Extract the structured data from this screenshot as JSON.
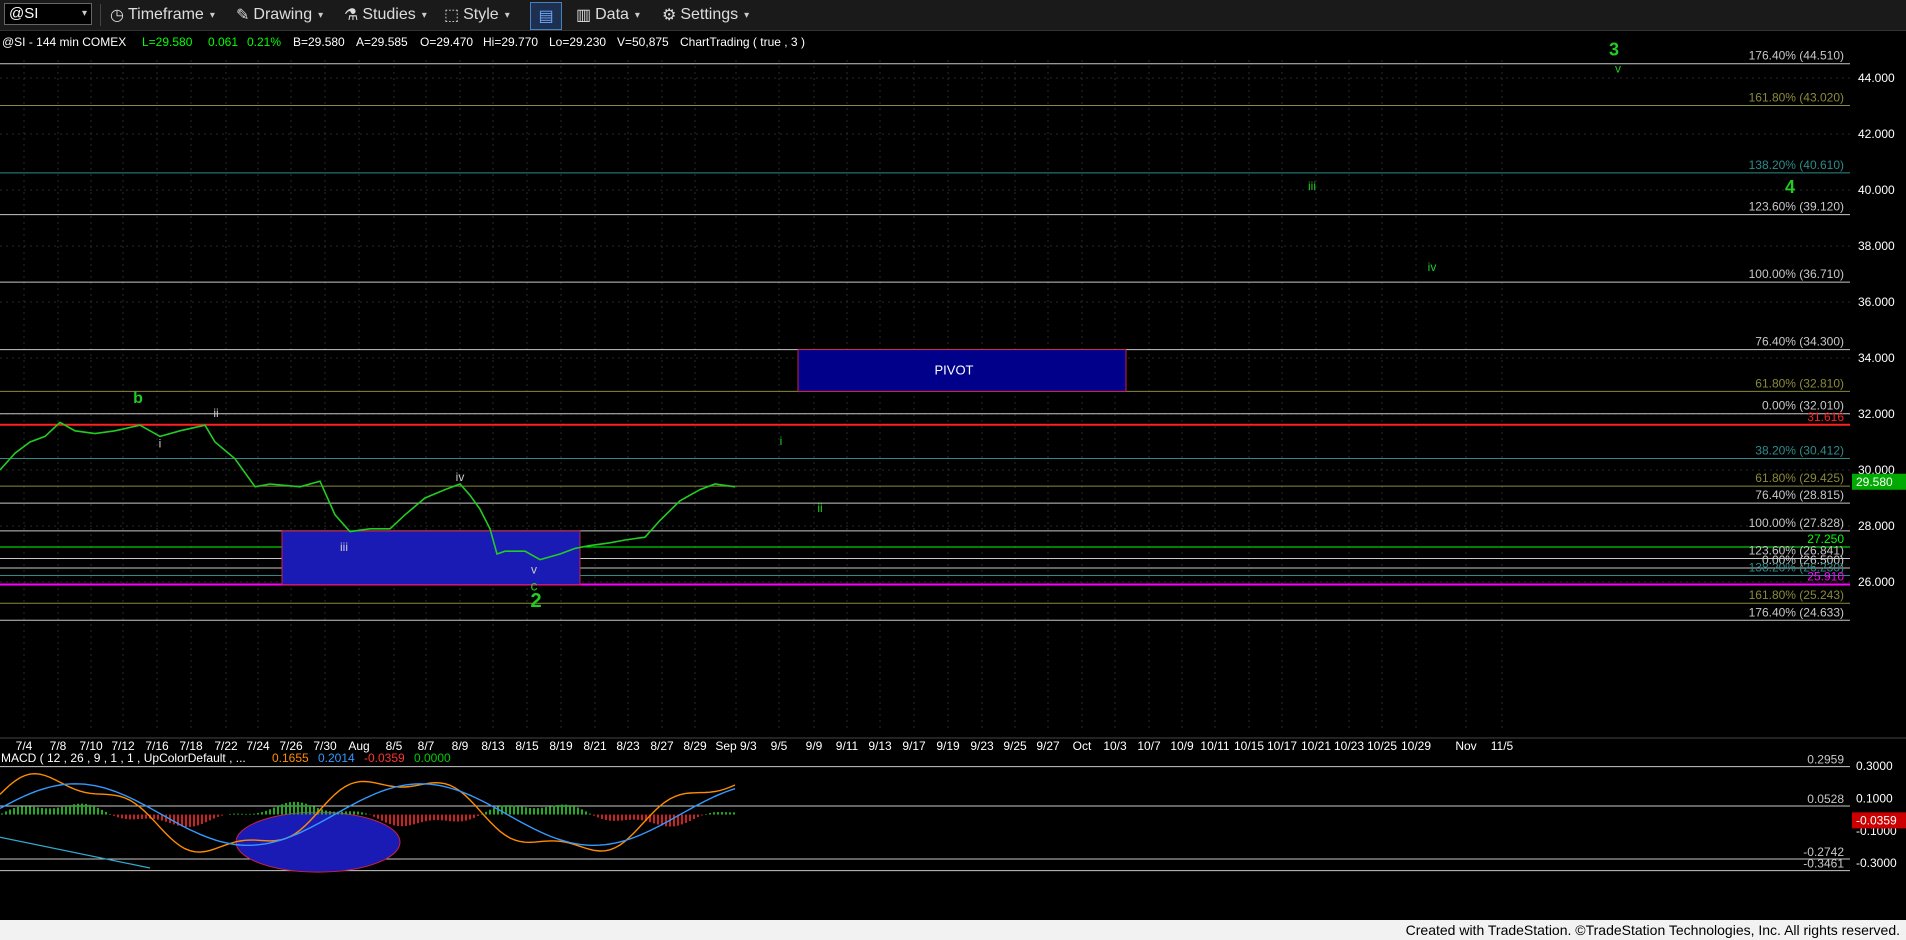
{
  "toolbar": {
    "symbol": "@SI",
    "timeframe": "Timeframe",
    "drawing": "Drawing",
    "studies": "Studies",
    "style": "Style",
    "data": "Data",
    "settings": "Settings"
  },
  "header": {
    "symbol_line": "@SI - 144 min  COMEX",
    "last": "L=29.580",
    "change": "0.061",
    "change_pct": "0.21%",
    "bid": "B=29.580",
    "ask": "A=29.585",
    "open": "O=29.470",
    "high": "Hi=29.770",
    "low": "Lo=29.230",
    "volume": "V=50,875",
    "study": "ChartTrading ( true , 3 )"
  },
  "price_axis": {
    "ticks": [
      "44.000",
      "42.000",
      "40.000",
      "38.000",
      "36.000",
      "34.000",
      "32.000",
      "30.000",
      "28.000",
      "26.000"
    ],
    "last_price": "29.580"
  },
  "fib_lines": [
    {
      "label": "176.40% (44.510)",
      "price": 44.51,
      "color": "#c8c8c8"
    },
    {
      "label": "161.80% (43.020)",
      "price": 43.02,
      "color": "#8a8a3a"
    },
    {
      "label": "138.20% (40.610)",
      "price": 40.61,
      "color": "#2e8b8b"
    },
    {
      "label": "123.60% (39.120)",
      "price": 39.12,
      "color": "#c8c8c8"
    },
    {
      "label": "100.00% (36.710)",
      "price": 36.71,
      "color": "#c8c8c8"
    },
    {
      "label": "76.40% (34.300)",
      "price": 34.3,
      "color": "#c8c8c8"
    },
    {
      "label": "61.80% (32.810)",
      "price": 32.81,
      "color": "#8a8a3a"
    },
    {
      "label": "0.00% (32.010)",
      "price": 32.01,
      "color": "#c8c8c8"
    },
    {
      "label": "31.616",
      "price": 31.616,
      "color": "#ff2020"
    },
    {
      "label": "38.20% (30.412)",
      "price": 30.412,
      "color": "#2e8b8b"
    },
    {
      "label": "61.80% (29.425)",
      "price": 29.425,
      "color": "#8a8a3a"
    },
    {
      "label": "76.40% (28.815)",
      "price": 28.815,
      "color": "#c8c8c8"
    },
    {
      "label": "100.00% (27.828)",
      "price": 27.828,
      "color": "#c8c8c8"
    },
    {
      "label": "27.250",
      "price": 27.25,
      "color": "#00ff00"
    },
    {
      "label": "123.60% (26.841)",
      "price": 26.841,
      "color": "#c8c8c8"
    },
    {
      "label": "0.00% (26.500)",
      "price": 26.5,
      "color": "#c8c8c8"
    },
    {
      "label": "138.20% (26.230)",
      "price": 26.23,
      "color": "#2e8b8b"
    },
    {
      "label": "25.910",
      "price": 25.91,
      "color": "#ff00ff"
    },
    {
      "label": "161.80% (25.243)",
      "price": 25.243,
      "color": "#8a8a3a"
    },
    {
      "label": "176.40% (24.633)",
      "price": 24.633,
      "color": "#c8c8c8"
    }
  ],
  "pivot": {
    "label": "PIVOT",
    "top": 34.3,
    "bottom": 32.81
  },
  "wave_labels": [
    {
      "text": "3",
      "price": 44.8,
      "col": "x3",
      "size": 18,
      "color": "#22cc22"
    },
    {
      "text": "v",
      "price": 44.2,
      "col": "xv3",
      "size": 12,
      "color": "#22cc22"
    },
    {
      "text": "iii",
      "price": 40.0,
      "col": "xiii",
      "size": 12,
      "color": "#22cc22"
    },
    {
      "text": "4",
      "price": 39.9,
      "col": "x4",
      "size": 18,
      "color": "#22cc22"
    },
    {
      "text": "iv",
      "price": 37.1,
      "col": "xiv",
      "size": 12,
      "color": "#22cc22"
    },
    {
      "text": "b",
      "price": 32.4,
      "col": "xb",
      "size": 16,
      "color": "#22cc22"
    },
    {
      "text": "ii",
      "price": 31.9,
      "col": "xii0",
      "size": 12,
      "color": "#cccccc"
    },
    {
      "text": "i",
      "price": 30.8,
      "col": "xi0",
      "size": 12,
      "color": "#cccccc"
    },
    {
      "text": "i",
      "price": 30.9,
      "col": "xi1",
      "size": 12,
      "color": "#22cc22"
    },
    {
      "text": "iv",
      "price": 29.6,
      "col": "xiv0",
      "size": 12,
      "color": "#cccccc"
    },
    {
      "text": "ii",
      "price": 28.5,
      "col": "xii1",
      "size": 12,
      "color": "#22cc22"
    },
    {
      "text": "iii",
      "price": 27.1,
      "col": "xiii0",
      "size": 12,
      "color": "#cccccc"
    },
    {
      "text": "v",
      "price": 26.3,
      "col": "xv0",
      "size": 12,
      "color": "#cccccc"
    },
    {
      "text": "c",
      "price": 25.7,
      "col": "xc",
      "size": 14,
      "color": "#22cc22"
    },
    {
      "text": "2",
      "price": 25.1,
      "col": "x2",
      "size": 20,
      "color": "#22cc22"
    }
  ],
  "macd": {
    "label": "MACD ( 12 , 26 , 9 , 1 , 1 , UpColorDefault , ...",
    "v1": "0.1655",
    "v2": "0.2014",
    "v3": "-0.0359",
    "v4": "0.0000",
    "levels": [
      {
        "label": "0.2959",
        "value": 0.2959
      },
      {
        "label": "0.0528",
        "value": 0.0528
      },
      {
        "label": "-0.2742",
        "value": -0.2742
      },
      {
        "label": "-0.3461",
        "value": -0.3461
      }
    ],
    "ticks": [
      "0.3000",
      "0.1000",
      "-0.1000",
      "-0.3000"
    ],
    "last": "-0.0359"
  },
  "dates": [
    "7/4",
    "7/8",
    "7/10",
    "7/12",
    "7/16",
    "7/18",
    "7/22",
    "7/24",
    "7/26",
    "7/30",
    "Aug",
    "8/5",
    "8/7",
    "8/9",
    "8/13",
    "8/15",
    "8/19",
    "8/21",
    "8/23",
    "8/27",
    "8/29",
    "Sep 9/3",
    "9/5",
    "9/9",
    "9/11",
    "9/13",
    "9/17",
    "9/19",
    "9/23",
    "9/25",
    "9/27",
    "Oct",
    "10/3",
    "10/7",
    "10/9",
    "10/11",
    "10/15",
    "10/17",
    "10/21",
    "10/23",
    "10/25",
    "10/29",
    "Nov",
    "11/5"
  ],
  "footer": "Created with TradeStation. ©TradeStation Technologies, Inc. All rights reserved.",
  "colors": {
    "price": "#22cc22",
    "pivot_box": "#00008b",
    "box_border": "#cc2244",
    "macd_fast": "#ff8c00",
    "macd_slow": "#3399ff",
    "hist_up": "#22aa22",
    "hist_down": "#cc2222"
  }
}
